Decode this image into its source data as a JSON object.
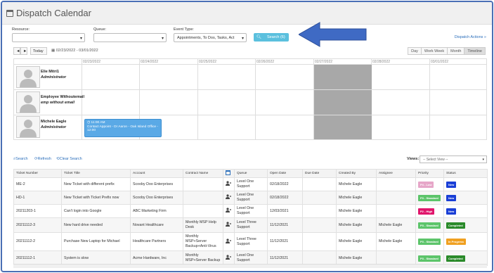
{
  "header": {
    "title": "Dispatch Calendar"
  },
  "filters": {
    "resource_label": "Resource:",
    "resource_value": "",
    "queue_label": "Queue:",
    "queue_value": "",
    "event_type_label": "Event Type:",
    "event_type_value": "Appointments, To Dos, Tasks, Act",
    "search_button": "Search (6)",
    "dispatch_actions": "Dispatch Actions »"
  },
  "toolbar": {
    "prev": "◄",
    "next": "►",
    "today": "Today",
    "date_range": "02/23/2022 - 03/01/2022",
    "views": [
      "Day",
      "Work Week",
      "Month",
      "Timeline"
    ],
    "active_view": "Timeline"
  },
  "calendar": {
    "dates": [
      "02/23/2022",
      "02/24/2022",
      "02/25/2022",
      "02/26/2022",
      "02/27/2022",
      "02/28/2022",
      "03/01/2022"
    ],
    "resources": [
      {
        "name": "Elie Mitri1",
        "role": "Administrator"
      },
      {
        "name": "Employee Withoutemail",
        "role": "emp without email"
      },
      {
        "name": "Michele Eagle",
        "role": "Administrator"
      }
    ],
    "event": {
      "time": "11:00 AM",
      "text": "Contact Appoint - Dr Aaron - Oak Island Office - 12:00"
    }
  },
  "grid_tools": {
    "search": "Search",
    "refresh": "Refresh",
    "clear_search": "Clear Search",
    "views_label": "Views:",
    "views_placeholder": "-- Select View --"
  },
  "table": {
    "columns": [
      "Ticket Number",
      "Ticket Title",
      "Account",
      "Contract Name",
      "",
      "Queue",
      "Open Date",
      "Due Date",
      "Created By",
      "Assignee",
      "Priority",
      "Status"
    ],
    "rows": [
      {
        "number": "ME-2",
        "title": "New Ticket with different prefix",
        "account": "Scooby Doo Enterprises",
        "contract": "",
        "queue": "Level One Support",
        "open": "02/18/2022",
        "due": "",
        "created_by": "Michele Eagle",
        "assignee": "",
        "priority": "P4 - Low",
        "status": "New"
      },
      {
        "number": "HD-1",
        "title": "New Ticket with Ticket Prefix now",
        "account": "Scooby Doo Enterprises",
        "contract": "",
        "queue": "Level One Support",
        "open": "02/18/2022",
        "due": "",
        "created_by": "Michele Eagle",
        "assignee": "",
        "priority": "P3 - Standard",
        "status": "New"
      },
      {
        "number": "20211203-1",
        "title": "Can't login into Google",
        "account": "ABC Marketing Firm",
        "contract": "",
        "queue": "Level One Support",
        "open": "12/03/2021",
        "due": "",
        "created_by": "Michele Eagle",
        "assignee": "",
        "priority": "P2 - High",
        "status": "New"
      },
      {
        "number": "20211112-3",
        "title": "New hard drive needed",
        "account": "Novant Healthcare",
        "contract": "Monthly MSP Help Desk",
        "queue": "Level Three Support",
        "open": "11/12/2021",
        "due": "",
        "created_by": "Michele Eagle",
        "assignee": "Michele Eagle",
        "priority": "P3 - Standard",
        "status": "Completed"
      },
      {
        "number": "20211112-2",
        "title": "Purchase New Laptop for Michael",
        "account": "Healthcare Partners",
        "contract": "Monthly MSP+Server Backup+Anti-Virus",
        "queue": "Level Three Support",
        "open": "11/12/2021",
        "due": "",
        "created_by": "Michele Eagle",
        "assignee": "Michele Eagle",
        "priority": "P3 - Standard",
        "status": "In Progress"
      },
      {
        "number": "20211112-1",
        "title": "System is slow",
        "account": "Acme Hardware, Inc",
        "contract": "Monthly MSP+Server Backup",
        "queue": "Level One Support",
        "open": "11/12/2021",
        "due": "",
        "created_by": "Michele Eagle",
        "assignee": "",
        "priority": "P3 - Standard",
        "status": "Completed"
      }
    ]
  },
  "colors": {
    "accent": "#2a6ebb",
    "search_button": "#5bc0de",
    "arrow": "#3f6ac4",
    "priority": {
      "P4 - Low": "#e6a6c8",
      "P3 - Standard": "#5cc46a",
      "P2 - High": "#e0156b"
    },
    "status": {
      "New": "#1a3fd6",
      "Completed": "#2a8a2a",
      "In Progress": "#f0a020"
    }
  }
}
